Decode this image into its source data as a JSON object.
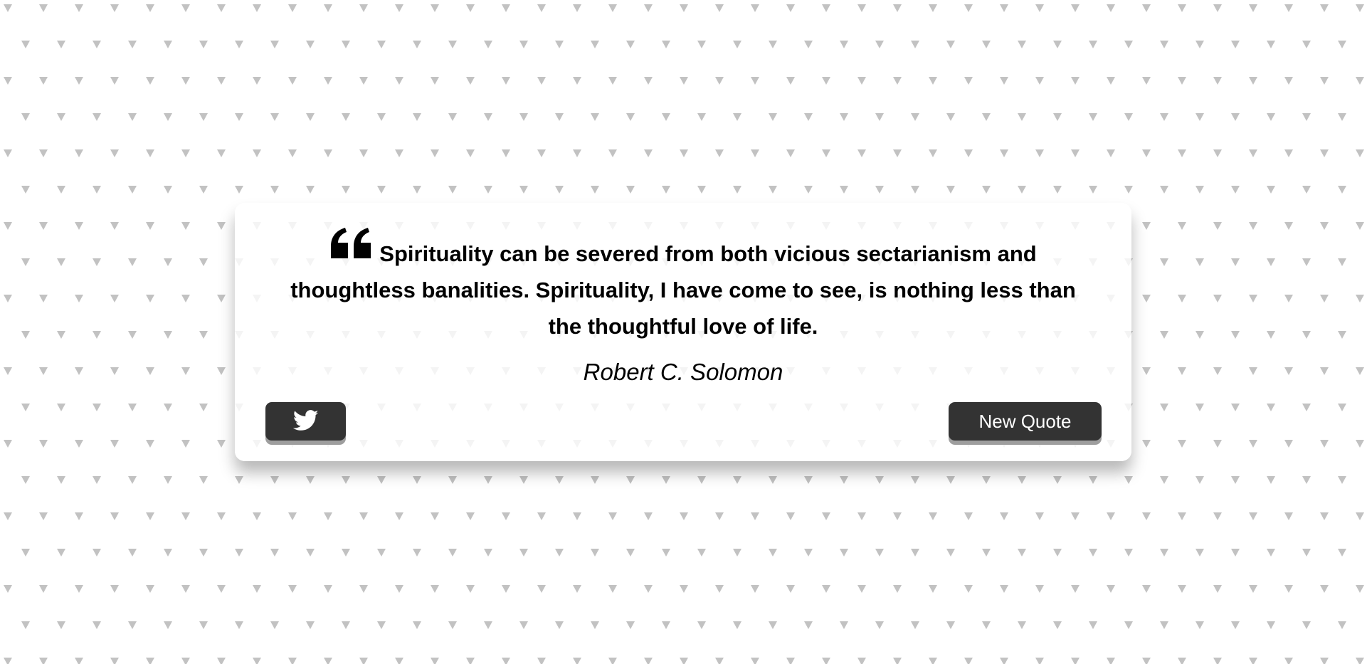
{
  "quote": {
    "text": "Spirituality can be severed from both vicious sectarianism and thoughtless banalities. Spirituality, I have come to see, is nothing less than the thoughtful love of life.",
    "author": "Robert C. Solomon"
  },
  "buttons": {
    "tweet_icon": "twitter-icon",
    "new_quote_label": "New Quote"
  },
  "colors": {
    "button_bg": "#333333",
    "button_shadow": "#9e9e9e",
    "pattern": "#c2c2c2",
    "card_bg": "#ffffff"
  }
}
